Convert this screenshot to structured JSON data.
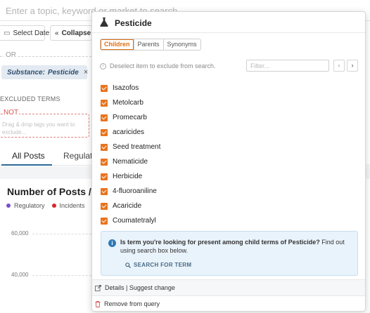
{
  "background": {
    "search_placeholder": "Enter a topic, keyword or market to search",
    "select_date_label": "Select Date",
    "collapse_label": "Collapse",
    "or_label": "OR",
    "tag": {
      "prefix": "Substance:",
      "value": "Pesticide"
    },
    "excluded_title": "EXCLUDED TERMS",
    "not_label": "NOT",
    "not_hint": "Drag & drop tags you want to exclude...",
    "tabs": [
      "All Posts",
      "Regulati"
    ],
    "chart_title": "Number of Posts / M",
    "legend": [
      {
        "label": "Regulatory",
        "color": "#7b4fd1"
      },
      {
        "label": "Incidents",
        "color": "#d9262c"
      },
      {
        "label": "",
        "color": "#2f7ab8"
      }
    ],
    "y_ticks": [
      "60,000",
      "40,000"
    ]
  },
  "popup": {
    "title": "Pesticide",
    "tabs": [
      "Children",
      "Parents",
      "Synonyms"
    ],
    "active_tab": "Children",
    "info": "Deselect item to exclude from search.",
    "filter_placeholder": "Filter...",
    "items": [
      "Isazofos",
      "Metolcarb",
      "Promecarb",
      "acaricides",
      "Seed treatment",
      "Nematicide",
      "Herbicide",
      "4-fluoroaniline",
      "Acaricide",
      "Coumatetralyl"
    ],
    "notice": {
      "bold_1": "Is term you're looking for present among child terms of Pesticide?",
      "rest": " Find out using search box below.",
      "link": "SEARCH FOR TERM"
    },
    "footer": {
      "details_label": "Details | Suggest change",
      "remove_label": "Remove from query"
    }
  }
}
